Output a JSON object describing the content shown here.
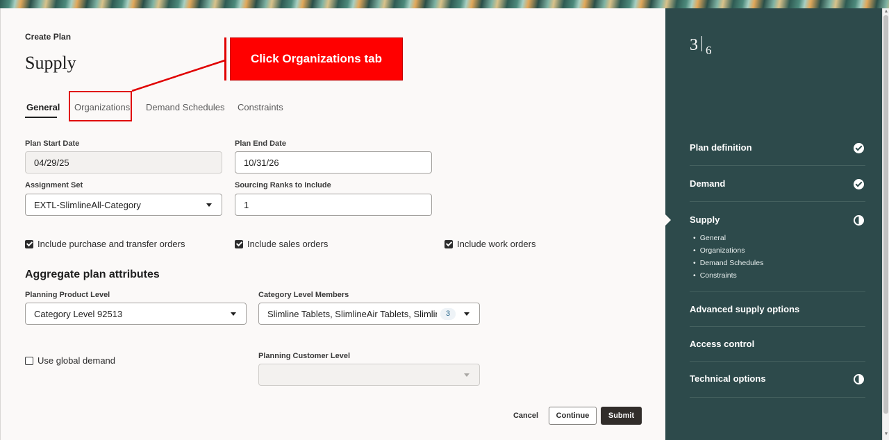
{
  "header": {
    "eyebrow": "Create Plan",
    "title": "Supply"
  },
  "tabs": [
    {
      "label": "General",
      "active": true
    },
    {
      "label": "Organizations",
      "active": false
    },
    {
      "label": "Demand Schedules",
      "active": false
    },
    {
      "label": "Constraints",
      "active": false
    }
  ],
  "fields": {
    "plan_start_date": {
      "label": "Plan Start Date",
      "value": "04/29/25"
    },
    "plan_end_date": {
      "label": "Plan End Date",
      "value": "10/31/26"
    },
    "assignment_set": {
      "label": "Assignment Set",
      "value": "EXTL-SlimlineAll-Category"
    },
    "sourcing_ranks": {
      "label": "Sourcing Ranks to Include",
      "value": "1"
    }
  },
  "checkboxes": {
    "purchase_transfer": {
      "label": "Include purchase and transfer orders",
      "checked": true
    },
    "sales_orders": {
      "label": "Include sales orders",
      "checked": true
    },
    "work_orders": {
      "label": "Include work orders",
      "checked": true
    },
    "global_demand": {
      "label": "Use global demand",
      "checked": false
    }
  },
  "aggregate": {
    "title": "Aggregate plan attributes",
    "planning_product_level": {
      "label": "Planning Product Level",
      "value": "Category Level 92513"
    },
    "category_level_members": {
      "label": "Category Level Members",
      "value": "Slimline Tablets, SlimlineAir Tablets, SlimlineM",
      "count": "3"
    },
    "planning_customer_level": {
      "label": "Planning Customer Level",
      "value": ""
    }
  },
  "actions": {
    "cancel": "Cancel",
    "continue": "Continue",
    "submit": "Submit"
  },
  "callout": {
    "text": "Click Organizations tab"
  },
  "sidebar": {
    "step_current": "3",
    "step_total": "6",
    "items": [
      {
        "label": "Plan definition",
        "status": "done"
      },
      {
        "label": "Demand",
        "status": "done"
      },
      {
        "label": "Supply",
        "status": "in-progress",
        "subitems": [
          "General",
          "Organizations",
          "Demand Schedules",
          "Constraints"
        ]
      },
      {
        "label": "Advanced supply options",
        "status": "none"
      },
      {
        "label": "Access control",
        "status": "none"
      },
      {
        "label": "Technical options",
        "status": "in-progress"
      }
    ]
  },
  "colors": {
    "sidebar_bg": "#2d4a4b",
    "annotation_red": "#ff0000",
    "primary_button": "#312d2a"
  }
}
